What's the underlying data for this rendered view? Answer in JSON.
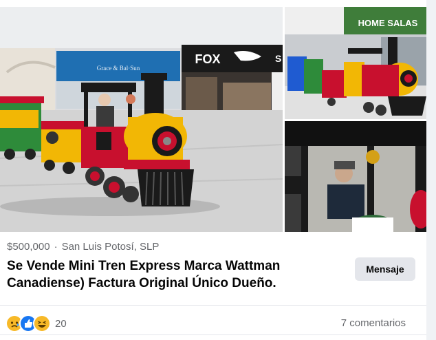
{
  "listing": {
    "price": "$500,000",
    "separator": "·",
    "location": "San Luis Potosí, SLP",
    "title": "Se Vende Mini Tren Express Marca Wattman Canadiense) Factura Original Único Dueño.",
    "message_button": "Mensaje"
  },
  "photos": {
    "store_sign": "FOX",
    "store_sign_2": "S",
    "shop_sign": "Grace & Bal·Sun",
    "mall_sign": "HOME SALAS"
  },
  "reactions": {
    "icons": [
      "sad-icon",
      "like-icon",
      "haha-icon"
    ],
    "count": "20"
  },
  "comments": "7 comentarios",
  "colors": {
    "train_red": "#c8102e",
    "train_yellow": "#f2b705",
    "train_green": "#2e8b3a",
    "like_blue": "#1877f2",
    "sad_yellow": "#f7b928"
  }
}
